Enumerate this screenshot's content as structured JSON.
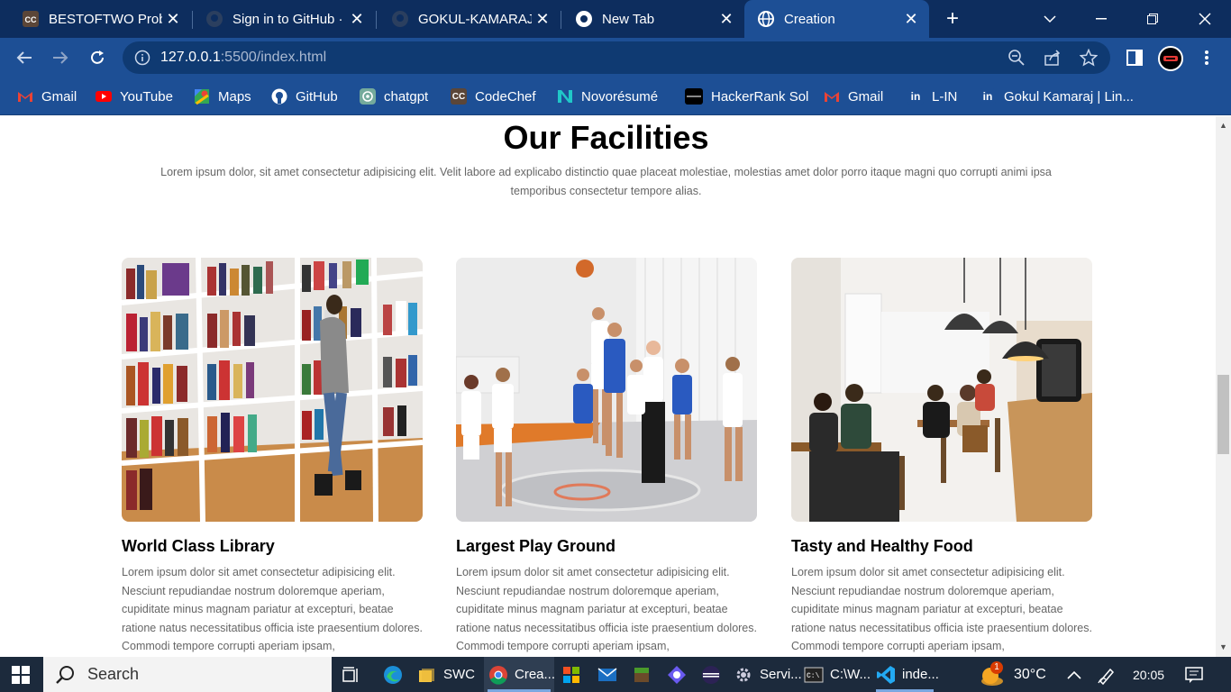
{
  "browser": {
    "tabs": [
      {
        "title": "BESTOFTWO Probl",
        "icon": "codechef-icon",
        "active": false
      },
      {
        "title": "Sign in to GitHub ·",
        "icon": "github-icon",
        "active": false
      },
      {
        "title": "GOKUL-KAMARAJ/",
        "icon": "github-icon",
        "active": false
      },
      {
        "title": "New Tab",
        "icon": "chrome-icon",
        "active": false
      },
      {
        "title": "Creation",
        "icon": "globe-icon",
        "active": true
      }
    ],
    "url_host": "127.0.0.1",
    "url_rest": ":5500/index.html",
    "bookmarks": [
      {
        "label": "Gmail",
        "icon": "gmail-icon"
      },
      {
        "label": "YouTube",
        "icon": "youtube-icon"
      },
      {
        "label": "Maps",
        "icon": "maps-icon"
      },
      {
        "label": "GitHub",
        "icon": "github-icon"
      },
      {
        "label": "chatgpt",
        "icon": "chatgpt-icon"
      },
      {
        "label": "CodeChef",
        "icon": "codechef-icon"
      },
      {
        "label": "Novorésumé",
        "icon": "novoresume-icon"
      },
      {
        "label": "HackerRank Sol",
        "icon": "hackerrank-icon"
      },
      {
        "label": "Gmail",
        "icon": "gmail-icon"
      },
      {
        "label": "L-IN",
        "icon": "linkedin-icon"
      },
      {
        "label": "Gokul Kamaraj | Lin...",
        "icon": "linkedin-icon"
      }
    ]
  },
  "page": {
    "title": "Our Facilities",
    "description": "Lorem ipsum dolor, sit amet consectetur adipisicing elit. Velit labore ad explicabo distinctio quae placeat molestiae, molestias amet dolor porro itaque magni quo corrupti animi ipsa temporibus consectetur tempore alias.",
    "cards": [
      {
        "title": "World Class Library",
        "text": "Lorem ipsum dolor sit amet consectetur adipisicing elit. Nesciunt repudiandae nostrum doloremque aperiam, cupiditate minus magnam pariatur at excepturi, beatae ratione natus necessitatibus officia iste praesentium dolores. Commodi tempore corrupti aperiam ipsam,"
      },
      {
        "title": "Largest Play Ground",
        "text": "Lorem ipsum dolor sit amet consectetur adipisicing elit. Nesciunt repudiandae nostrum doloremque aperiam, cupiditate minus magnam pariatur at excepturi, beatae ratione natus necessitatibus officia iste praesentium dolores. Commodi tempore corrupti aperiam ipsam,"
      },
      {
        "title": "Tasty and Healthy Food",
        "text": "Lorem ipsum dolor sit amet consectetur adipisicing elit. Nesciunt repudiandae nostrum doloremque aperiam, cupiditate minus magnam pariatur at excepturi, beatae ratione natus necessitatibus officia iste praesentium dolores. Commodi tempore corrupti aperiam ipsam,"
      }
    ]
  },
  "taskbar": {
    "search_label": "Search",
    "apps": [
      {
        "label": "",
        "icon": "task-view-icon"
      },
      {
        "label": "",
        "icon": "edge-icon"
      },
      {
        "label": "SWC",
        "icon": "folder-icon"
      },
      {
        "label": "Crea...",
        "icon": "chrome-icon"
      },
      {
        "label": "",
        "icon": "store-icon"
      },
      {
        "label": "",
        "icon": "mail-icon"
      },
      {
        "label": "",
        "icon": "minecraft-icon"
      },
      {
        "label": "",
        "icon": "app-icon"
      },
      {
        "label": "",
        "icon": "eclipse-icon"
      },
      {
        "label": "Servi...",
        "icon": "gear-icon"
      },
      {
        "label": "C:\\W...",
        "icon": "terminal-icon"
      },
      {
        "label": "inde...",
        "icon": "vscode-icon"
      }
    ],
    "weather_badge": "1",
    "temperature": "30°C",
    "time": "20:05"
  }
}
